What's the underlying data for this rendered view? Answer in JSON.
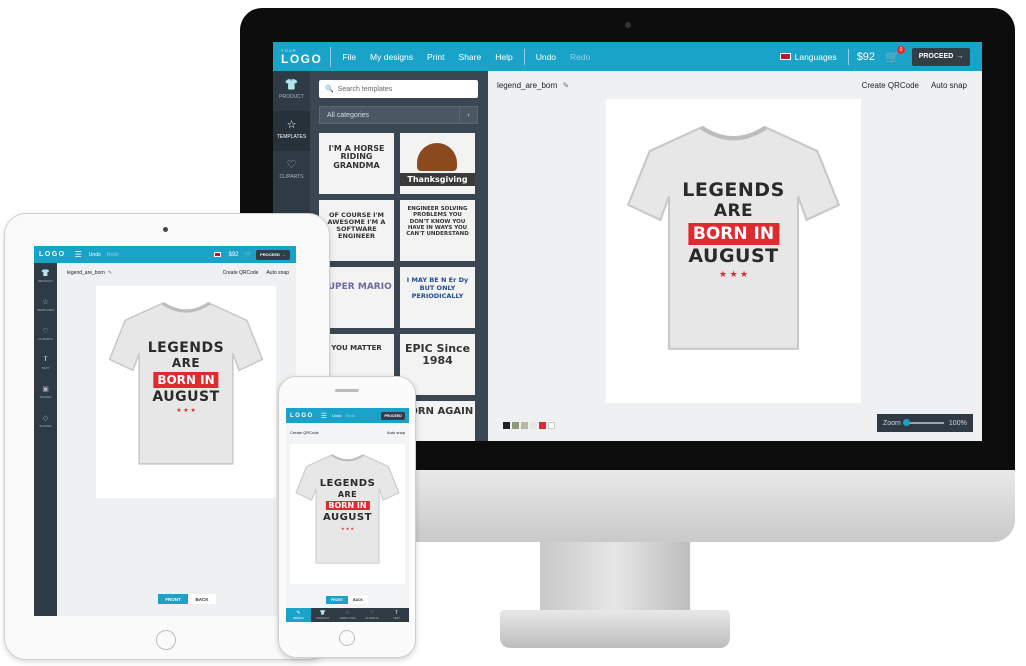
{
  "brand": {
    "logo_small": "YOUR",
    "logo": "LOGO"
  },
  "desktop": {
    "menu": [
      "File",
      "My designs",
      "Print",
      "Share",
      "Help"
    ],
    "undo": "Undo",
    "redo": "Redo",
    "languages": "Languages",
    "price": "$92",
    "cart_count": "0",
    "proceed": "PROCEED",
    "sidebar": [
      {
        "icon": "tshirt-icon",
        "label": "PRODUCT"
      },
      {
        "icon": "star-icon",
        "label": "TEMPLATES"
      },
      {
        "icon": "heart-icon",
        "label": "CLIPARTS"
      }
    ],
    "search_placeholder": "Search templates",
    "category": "All categories",
    "templates": [
      {
        "name": "horse-riding-grandma",
        "text": "I'M A HORSE RIDING GRANDMA"
      },
      {
        "name": "thanksgiving",
        "text": "Thanksgiving"
      },
      {
        "name": "software-engineer",
        "text": "OF COURSE I'M AWESOME I'M A SOFTWARE ENGINEER"
      },
      {
        "name": "engineer-solving-problems",
        "text": "ENGINEER SOLVING PROBLEMS YOU DON'T KNOW YOU HAVE IN WAYS YOU CAN'T UNDERSTAND"
      },
      {
        "name": "super-mario",
        "text": "SUPER MARIO"
      },
      {
        "name": "nerdy",
        "text": "I MAY BE N Er Dy BUT ONLY PERIODICALLY"
      },
      {
        "name": "you-matter",
        "text": "YOU MATTER"
      },
      {
        "name": "epic-1984",
        "text": "EPIC Since 1984"
      },
      {
        "name": "blank",
        "text": ""
      },
      {
        "name": "born-again",
        "text": "BORN AGAIN"
      }
    ],
    "design_name": "legend_are_born",
    "create_qr": "Create QRCode",
    "auto_snap": "Auto snap",
    "swatch_colors": [
      "#222222",
      "#8a9a78",
      "#b7b9a2",
      "#e6e6e6",
      "#e12a2f",
      "#ffffff"
    ],
    "zoom_label": "Zoom",
    "zoom_value": "100%"
  },
  "shirt_design": {
    "line1": "LEGENDS",
    "line2": "ARE",
    "line3": "BORN IN",
    "line4": "AUGUST",
    "stars": "★ ★ ★"
  },
  "tablet": {
    "undo": "Undo",
    "redo": "Redo",
    "price": "$92",
    "proceed": "PROCEED",
    "sidebar": [
      "PRODUCT",
      "TEMPLATES",
      "CLIPARTS",
      "TEXT",
      "IMAGES",
      "SHAPES"
    ],
    "design_name": "legend_are_born",
    "create_qr": "Create QRCode",
    "auto_snap": "Auto snap",
    "front": "FRONT",
    "back": "BACK"
  },
  "phone": {
    "undo": "Undo",
    "redo": "Redo",
    "proceed": "PROCEED",
    "create_qr": "Create QRCode",
    "auto_snap": "Auto snap",
    "front": "FRONT",
    "back": "BACK",
    "tabs": [
      "DESIGN",
      "PRODUCT",
      "TEMPLATES",
      "CLIPARTS",
      "TEXT"
    ]
  }
}
